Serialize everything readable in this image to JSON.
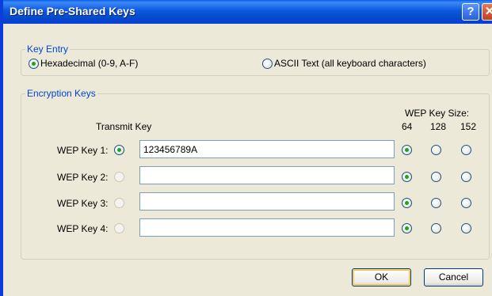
{
  "window": {
    "title": "Define Pre-Shared Keys",
    "help_label": "?",
    "close_label": "✕"
  },
  "key_entry": {
    "legend": "Key Entry",
    "options": [
      {
        "label": "Hexadecimal (0-9, A-F)",
        "selected": true
      },
      {
        "label": "ASCII Text (all keyboard characters)",
        "selected": false
      }
    ]
  },
  "encryption_keys": {
    "legend": "Encryption Keys",
    "transmit_key_label": "Transmit Key",
    "wep_key_size_label": "WEP Key Size:",
    "sizes": [
      "64",
      "128",
      "152"
    ],
    "keys": [
      {
        "label": "WEP Key 1:",
        "value": "123456789A",
        "transmit": true,
        "size": "64"
      },
      {
        "label": "WEP Key 2:",
        "value": "",
        "transmit": false,
        "size": "64"
      },
      {
        "label": "WEP Key 3:",
        "value": "",
        "transmit": false,
        "size": "64"
      },
      {
        "label": "WEP Key 4:",
        "value": "",
        "transmit": false,
        "size": "64"
      }
    ]
  },
  "buttons": {
    "ok": "OK",
    "cancel": "Cancel"
  }
}
